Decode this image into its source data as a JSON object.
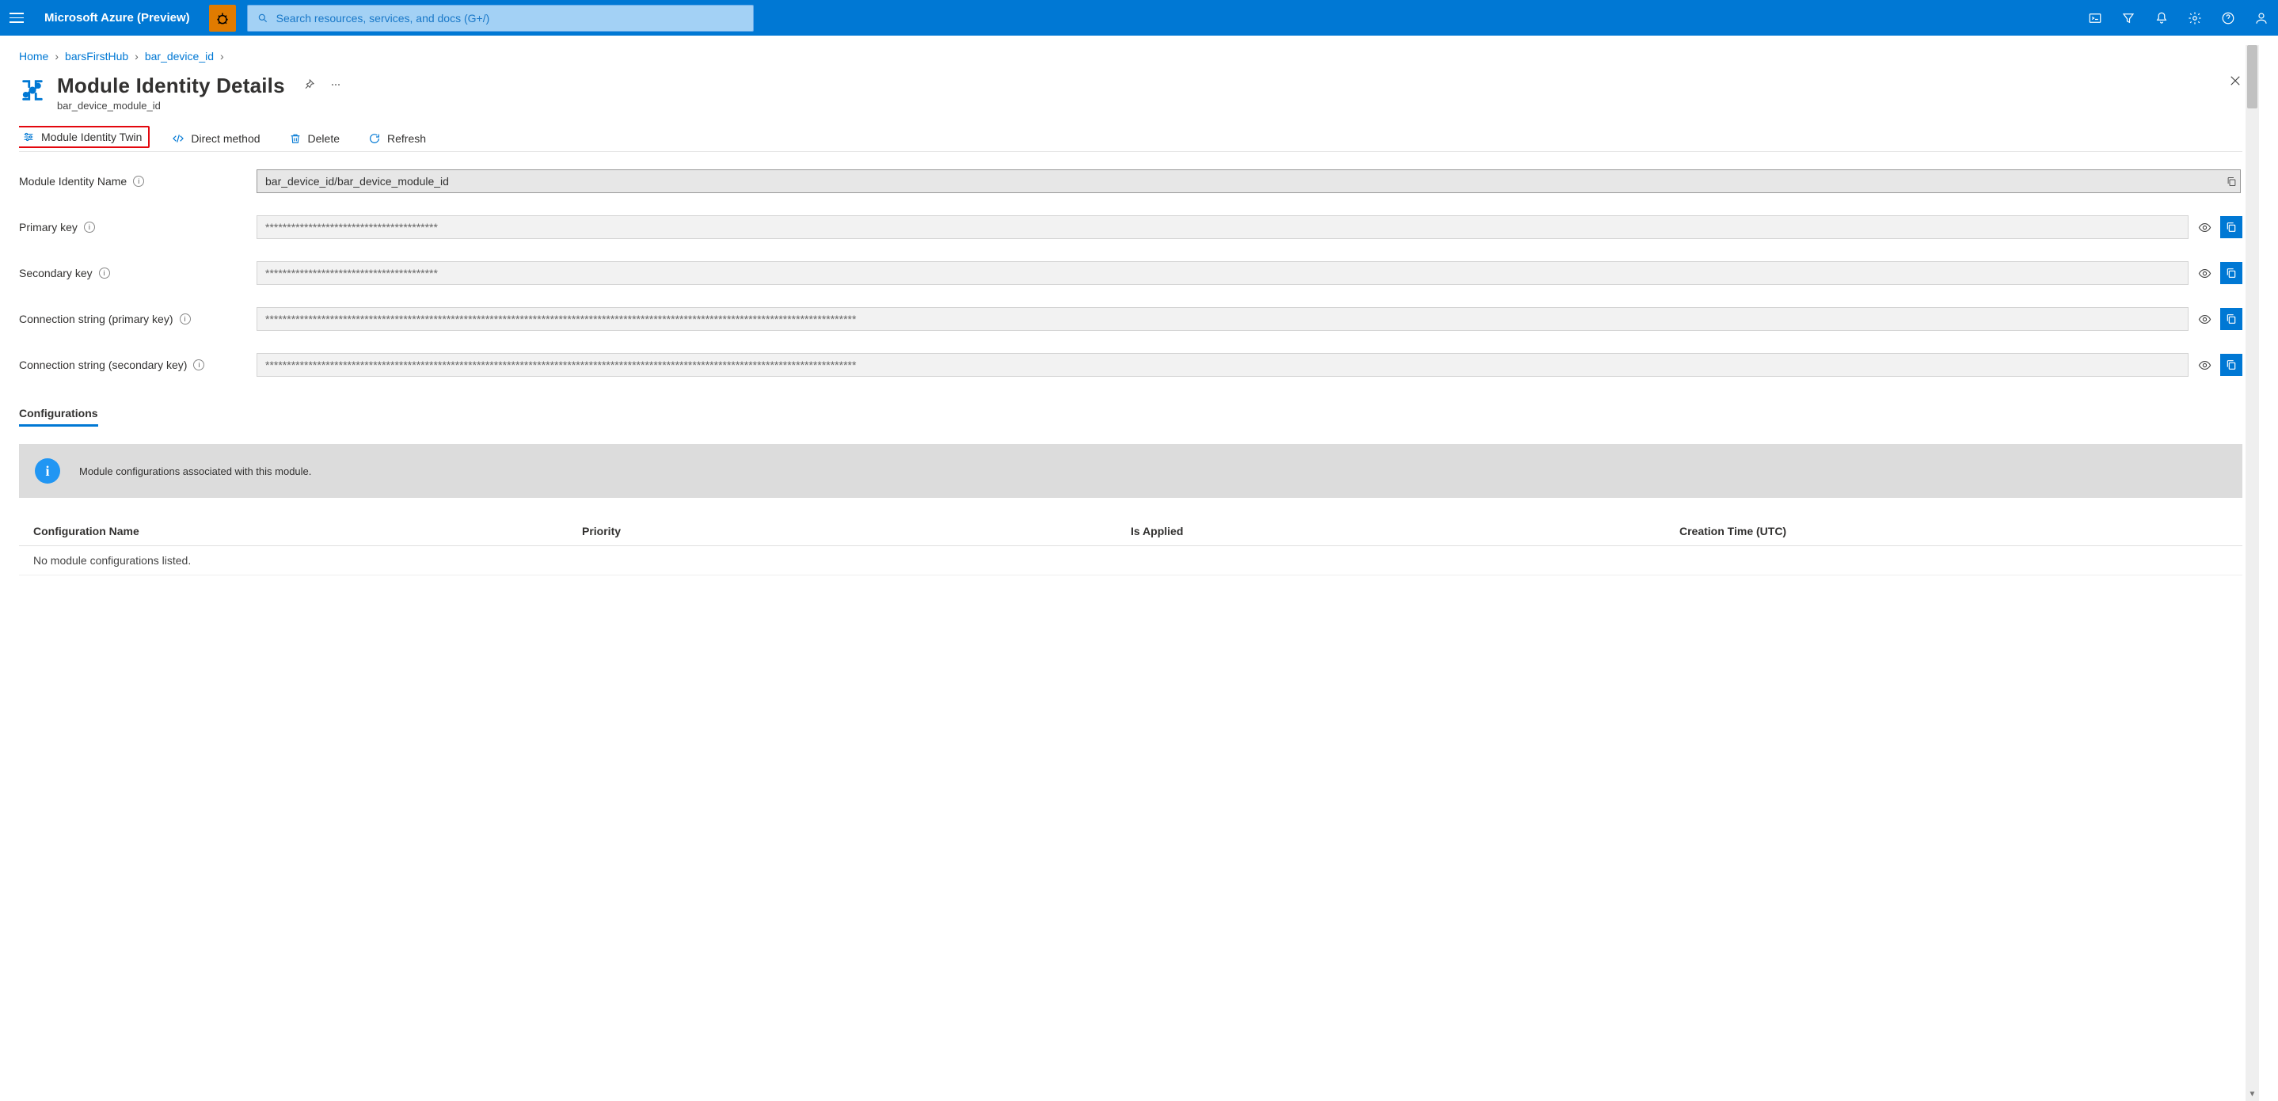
{
  "brand": "Microsoft Azure (Preview)",
  "search": {
    "placeholder": "Search resources, services, and docs (G+/)"
  },
  "breadcrumb": [
    {
      "label": "Home"
    },
    {
      "label": "barsFirstHub"
    },
    {
      "label": "bar_device_id"
    }
  ],
  "header": {
    "title": "Module Identity Details",
    "subtitle": "bar_device_module_id"
  },
  "toolbar": {
    "identity_twin": "Module Identity Twin",
    "direct_method": "Direct method",
    "delete": "Delete",
    "refresh": "Refresh"
  },
  "fields": {
    "module_identity_name": {
      "label": "Module Identity Name",
      "value": "bar_device_id/bar_device_module_id"
    },
    "primary_key": {
      "label": "Primary key",
      "value": "****************************************"
    },
    "secondary_key": {
      "label": "Secondary key",
      "value": "****************************************"
    },
    "conn_primary": {
      "label": "Connection string (primary key)",
      "value": "*****************************************************************************************************************************************"
    },
    "conn_secondary": {
      "label": "Connection string (secondary key)",
      "value": "*****************************************************************************************************************************************"
    }
  },
  "config": {
    "heading": "Configurations",
    "banner": "Module configurations associated with this module.",
    "columns": [
      "Configuration Name",
      "Priority",
      "Is Applied",
      "Creation Time (UTC)"
    ],
    "empty_row": "No module configurations listed."
  }
}
